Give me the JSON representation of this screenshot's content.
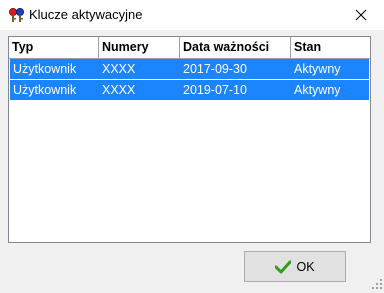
{
  "window": {
    "title": "Klucze aktywacyjne"
  },
  "list": {
    "columns": [
      "Typ",
      "Numery",
      "Data ważności",
      "Stan"
    ],
    "rows": [
      [
        "Użytkownik",
        "XXXX",
        "2017-09-30",
        "Aktywny"
      ],
      [
        "Użytkownik",
        "XXXX",
        "2019-07-10",
        "Aktywny"
      ]
    ],
    "selection_color": "#1b84ff"
  },
  "buttons": {
    "ok_label": "OK"
  },
  "icons": {
    "app": "keys-icon",
    "close": "close-icon",
    "ok": "check-icon",
    "grip": "resize-grip-icon"
  }
}
